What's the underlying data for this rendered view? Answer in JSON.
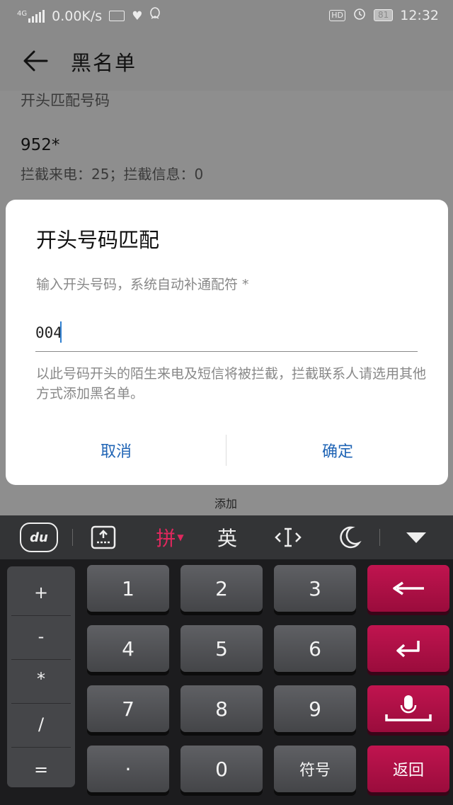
{
  "status_bar": {
    "network": "4G",
    "speed": "0.00K/s",
    "hd_badge": "HD",
    "battery": "81",
    "time": "12:32"
  },
  "app_bar": {
    "title": "黑名单"
  },
  "list": {
    "section_header": "开头匹配号码",
    "item_number": "952*",
    "item_stats": "拦截来电：25；拦截信息：0",
    "add_label": "添加"
  },
  "dialog": {
    "title": "开头号码匹配",
    "hint": "输入开头号码，系统自动补通配符 *",
    "input_value": "004",
    "description": "以此号码开头的陌生来电及短信将被拦截，拦截联系人请选用其他方式添加黑名单。",
    "cancel_label": "取消",
    "ok_label": "确定"
  },
  "keyboard": {
    "toolbar": {
      "du_label": "du",
      "pinyin_label": "拼",
      "english_label": "英"
    },
    "left_column": [
      "+",
      "-",
      "*",
      "/",
      "="
    ],
    "digits": [
      "1",
      "2",
      "3",
      "4",
      "5",
      "6",
      "7",
      "8",
      "9"
    ],
    "dot_label": "·",
    "zero_label": "0",
    "symbols_label": "符号",
    "return_label": "返回",
    "accent_color": "#b8114a"
  }
}
